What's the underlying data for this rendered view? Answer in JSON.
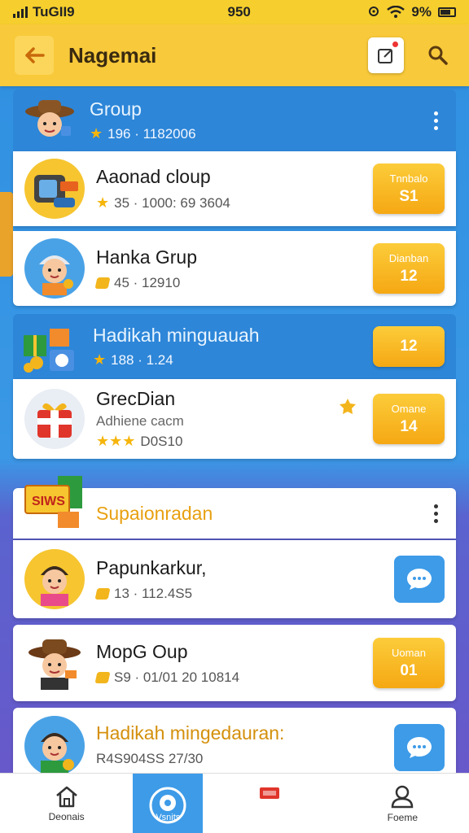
{
  "status_bar": {
    "carrier": "TuGII9",
    "time": "950",
    "battery": "9%"
  },
  "header": {
    "title": "Nagemai"
  },
  "group1": {
    "title": "Group",
    "sub": "196 · 1182006"
  },
  "rows1": [
    {
      "title": "Aaonad cloup",
      "sub": "35 · 1000: 69 3604",
      "cta1": "Tnnbalo",
      "cta2": "S1"
    },
    {
      "title": "Hanka Grup",
      "sub": "45 · 12910",
      "cta1": "Dianban",
      "cta2": "12"
    }
  ],
  "group2": {
    "title": "Hadikah minguauah",
    "sub": "188 · 1.24",
    "cta": "12"
  },
  "row3": {
    "title": "GrecDian",
    "line2": "Adhiene cacm",
    "sub": "D0S10",
    "cta1": "Omane",
    "cta2": "14"
  },
  "group3": {
    "title": "Supaionradan"
  },
  "rows4": [
    {
      "title": "Papunkarkur,",
      "sub": "13 · 112.4S5"
    },
    {
      "title": "MopG Oup",
      "sub": "S9 · 01/01 20 10814",
      "cta1": "Uoman",
      "cta2": "01"
    },
    {
      "title": "Hadikah mingedauran:",
      "sub": "R4S904SS 27/30"
    }
  ],
  "nav": {
    "left": "Deonais",
    "center": "Vsnits",
    "right": "Foeme"
  },
  "colors": {
    "accent": "#f8c93a",
    "blue": "#2d86d8",
    "button": "#f5a813"
  }
}
